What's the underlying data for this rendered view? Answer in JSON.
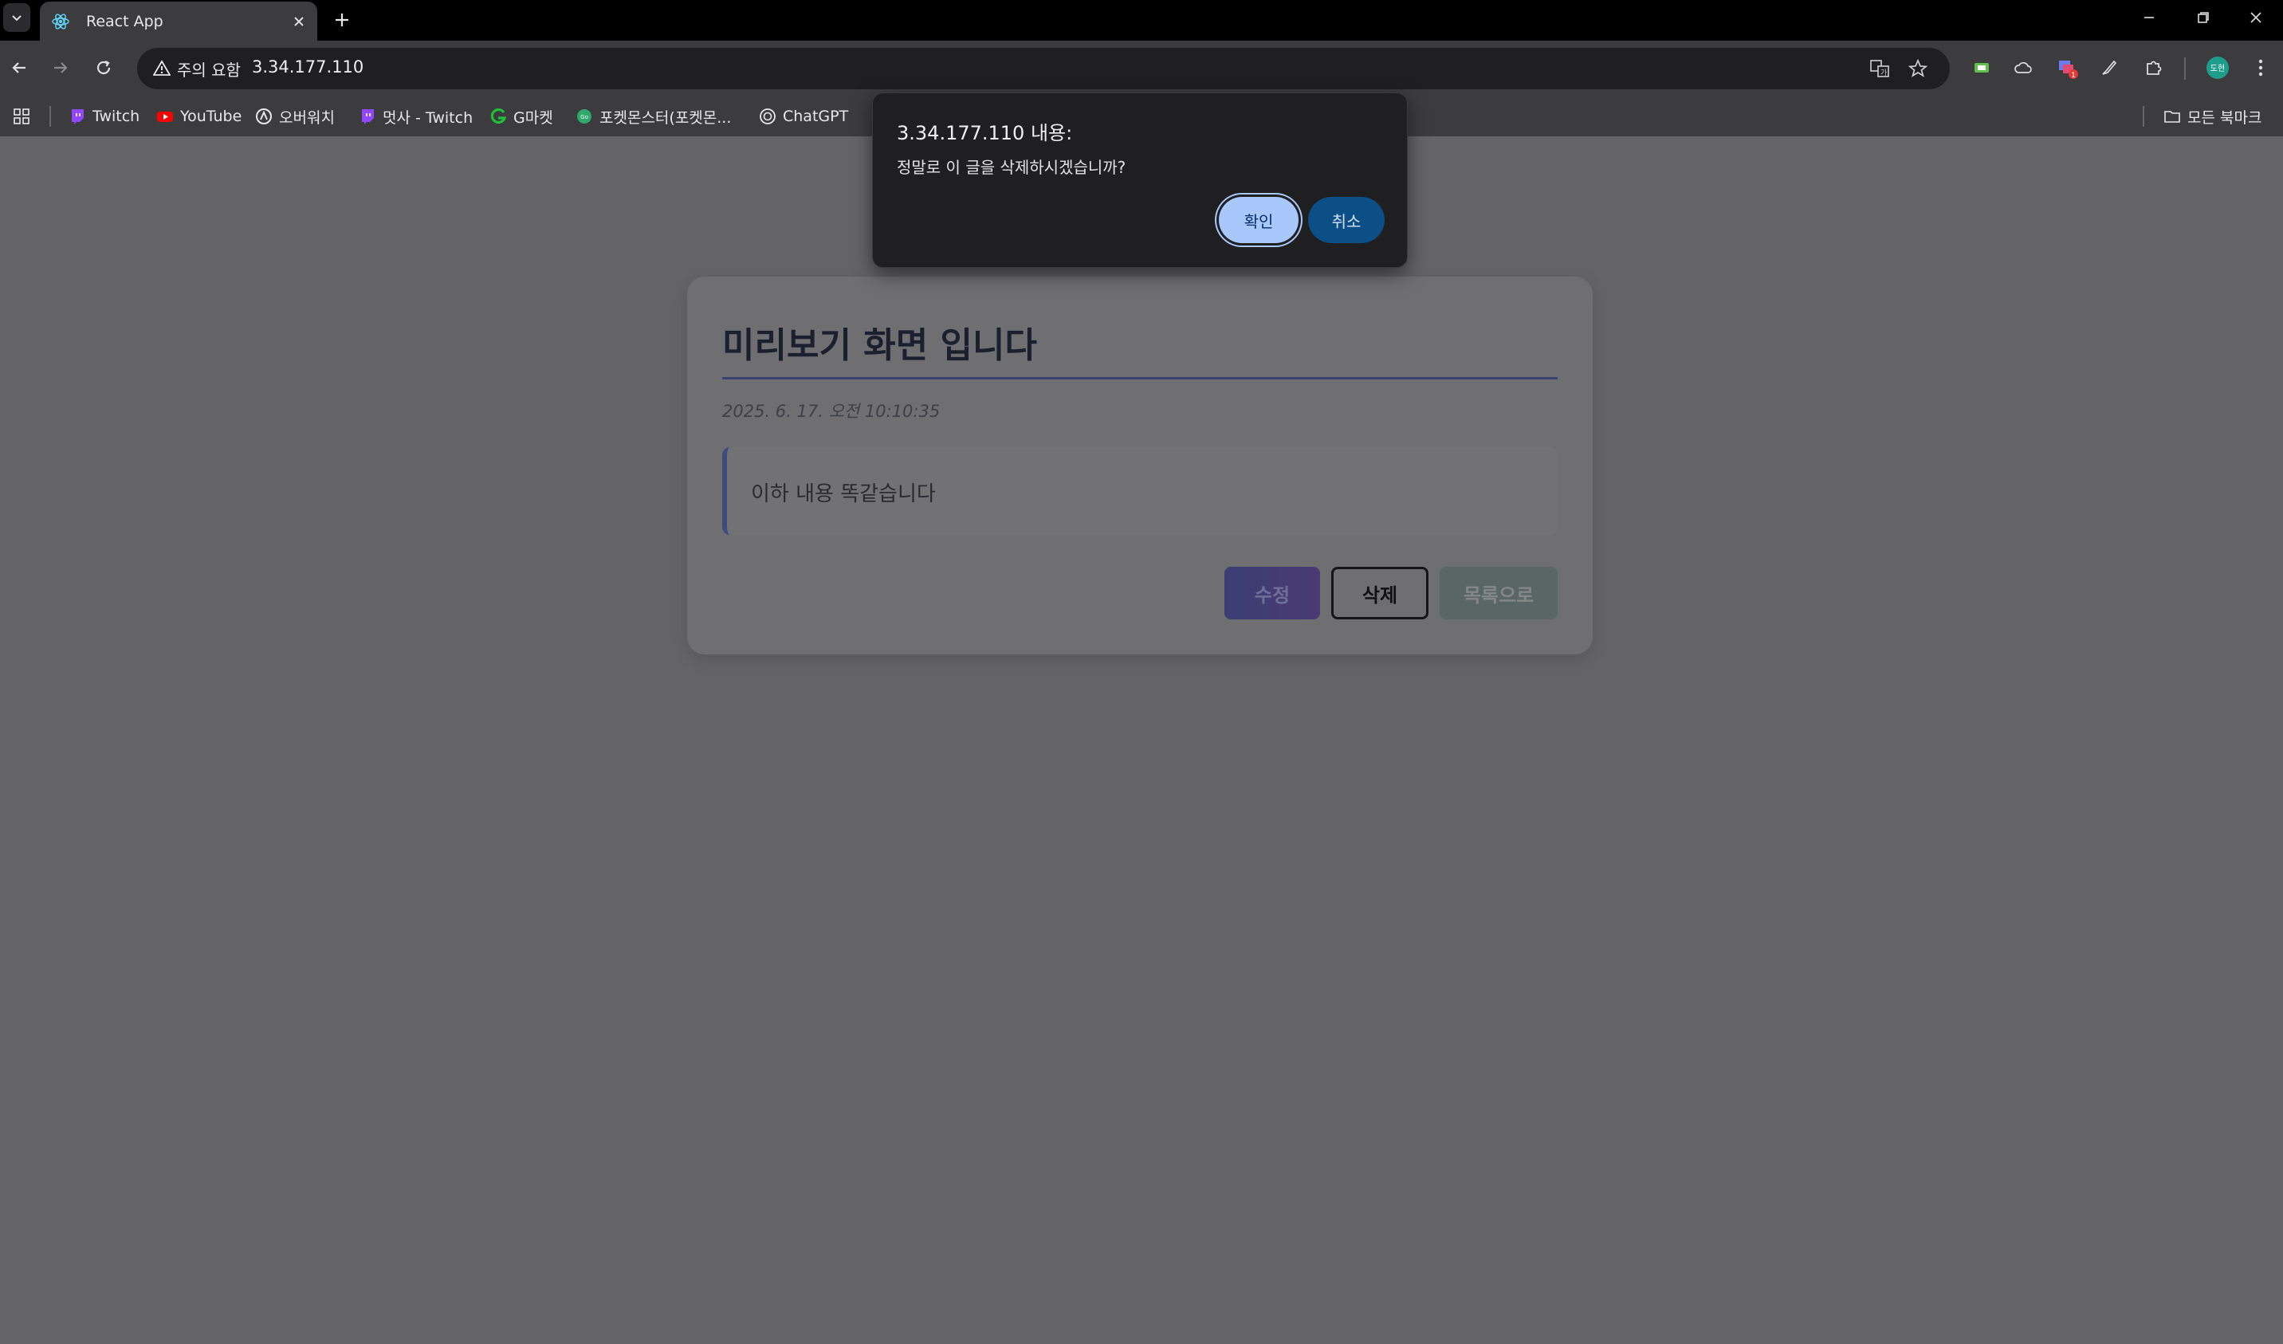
{
  "browser": {
    "tab_title": "React App",
    "security_label": "주의 요함",
    "url": "3.34.177.110",
    "bookmarks": [
      {
        "label": "Twitch",
        "icon": "twitch-icon"
      },
      {
        "label": "YouTube",
        "icon": "youtube-icon"
      },
      {
        "label": "오버워치",
        "icon": "overwatch-icon"
      },
      {
        "label": "멋사 - Twitch",
        "icon": "twitch-icon"
      },
      {
        "label": "G마켓",
        "icon": "gmarket-icon"
      },
      {
        "label": "포켓몬스터(포켓몬...",
        "icon": "pokemon-icon"
      },
      {
        "label": "ChatGPT",
        "icon": "chatgpt-icon"
      }
    ],
    "all_bookmarks_label": "모든 북마크",
    "profile_initials": "도현",
    "extension_badge": "1"
  },
  "post": {
    "title": "미리보기 화면 입니다",
    "date": "2025. 6. 17. 오전 10:10:35",
    "content": "이하 내용 똑같습니다",
    "edit_label": "수정",
    "delete_label": "삭제",
    "list_label": "목록으로"
  },
  "dialog": {
    "title": "3.34.177.110 내용:",
    "message": "정말로 이 글을 삭제하시겠습니까?",
    "ok_label": "확인",
    "cancel_label": "취소"
  },
  "colors": {
    "page_background": "#646467",
    "dialog_ok": "#a8c7fa",
    "dialog_cancel": "#0b4f86",
    "accent_rule": "#3a4270"
  }
}
